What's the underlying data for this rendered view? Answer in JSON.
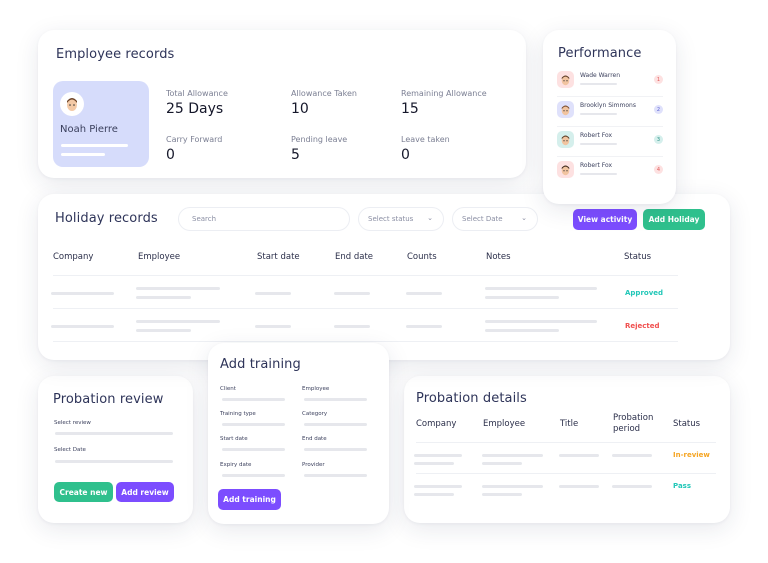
{
  "employee_records": {
    "title": "Employee records",
    "profile": {
      "name": "Noah Pierre",
      "avatar_icon": "man-avatar-icon"
    },
    "stats": [
      {
        "label": "Total Allowance",
        "value": "25 Days"
      },
      {
        "label": "Allowance Taken",
        "value": "10"
      },
      {
        "label": "Remaining Allowance",
        "value": "15"
      },
      {
        "label": "Carry Forward",
        "value": "0"
      },
      {
        "label": "Pending leave",
        "value": "5"
      },
      {
        "label": "Leave taken",
        "value": "0"
      }
    ]
  },
  "performance": {
    "title": "Performance",
    "people": [
      {
        "name": "Wade Warren",
        "rank": "1",
        "avatar_icon": "man-avatar-icon",
        "avatar_bg": "#fde1e1",
        "rank_bg": "#fde1e1",
        "rank_color": "#e05a5a"
      },
      {
        "name": "Brooklyn Simmons",
        "rank": "2",
        "avatar_icon": "woman-avatar-icon",
        "avatar_bg": "#dfe1fb",
        "rank_bg": "#dfe1fb",
        "rank_color": "#5a5fd0"
      },
      {
        "name": "Robert Fox",
        "rank": "3",
        "avatar_icon": "man-avatar-icon",
        "avatar_bg": "#d5efec",
        "rank_bg": "#d5efec",
        "rank_color": "#2a8f84"
      },
      {
        "name": "Robert Fox",
        "rank": "4",
        "avatar_icon": "man-curly-avatar-icon",
        "avatar_bg": "#fde1e1",
        "rank_bg": "#fde1e1",
        "rank_color": "#e05a5a"
      }
    ]
  },
  "holiday_records": {
    "title": "Holiday records",
    "search_placeholder": "Search",
    "status_select": "Select status",
    "date_select": "Select Date",
    "view_activity_label": "View activity",
    "add_holiday_label": "Add Holiday",
    "columns": [
      "Company",
      "Employee",
      "Start date",
      "End date",
      "Counts",
      "Notes",
      "Status"
    ],
    "rows": [
      {
        "status": "Approved",
        "status_color": "#22c7b8"
      },
      {
        "status": "Rejected",
        "status_color": "#f0504f"
      }
    ]
  },
  "probation_review": {
    "title": "Probation review",
    "fields": [
      "Select review",
      "Select Date"
    ],
    "create_new_label": "Create new",
    "add_review_label": "Add review"
  },
  "add_training": {
    "title": "Add training",
    "fields": [
      "Client",
      "Employee",
      "Training type",
      "Category",
      "Start date",
      "End date",
      "Expiry date",
      "Provider"
    ],
    "submit_label": "Add training"
  },
  "probation_details": {
    "title": "Probation details",
    "columns": [
      "Company",
      "Employee",
      "Title",
      "Probation period",
      "Status"
    ],
    "rows": [
      {
        "status": "In-review",
        "status_color": "#f5a524"
      },
      {
        "status": "Pass",
        "status_color": "#22c7b8"
      }
    ]
  },
  "colors": {
    "purple": "#7c4dff",
    "green": "#2fc08d",
    "profile_bg": "#d6dcfb"
  }
}
